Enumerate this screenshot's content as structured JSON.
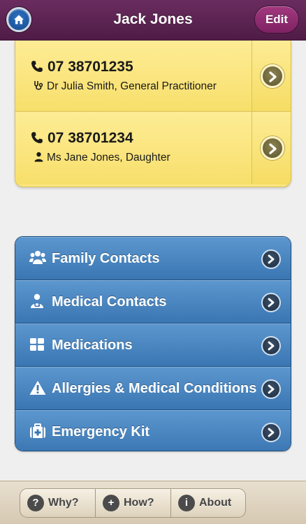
{
  "header": {
    "title": "Jack Jones",
    "home_icon": "home-icon",
    "edit_label": "Edit"
  },
  "contacts": [
    {
      "phone": "07 38701235",
      "name": "Dr Julia Smith, General Practitioner",
      "icon": "stethoscope-icon"
    },
    {
      "phone": "07 38701234",
      "name": "Ms Jane Jones, Daughter",
      "icon": "person-icon"
    }
  ],
  "menu": {
    "items": [
      {
        "label": "Family Contacts",
        "icon": "group-icon"
      },
      {
        "label": "Medical Contacts",
        "icon": "doctor-icon"
      },
      {
        "label": "Medications",
        "icon": "grid-icon"
      },
      {
        "label": "Allergies & Medical Conditions",
        "icon": "warning-icon"
      },
      {
        "label": "Emergency Kit",
        "icon": "medical-kit-icon"
      }
    ]
  },
  "toolbar": {
    "why": {
      "label": "Why?",
      "glyph": "?"
    },
    "how": {
      "label": "How?",
      "glyph": "+"
    },
    "about": {
      "label": "About",
      "glyph": "i"
    }
  },
  "colors": {
    "header": "#5e2453",
    "edit_button": "#922e75",
    "card_yellow": "#fbe682",
    "menu_blue": "#4a86c2",
    "footer": "#e0d6c2"
  }
}
